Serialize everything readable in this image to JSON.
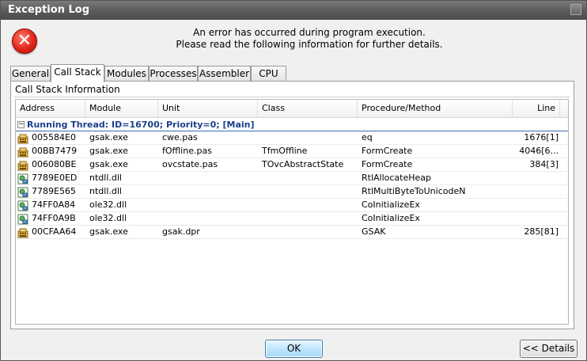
{
  "window": {
    "title": "Exception Log"
  },
  "message": {
    "line1": "An error has occurred during program execution.",
    "line2": "Please read the following information for further details."
  },
  "tabs": [
    "General",
    "Call Stack",
    "Modules",
    "Processes",
    "Assembler",
    "CPU"
  ],
  "active_tab": "Call Stack",
  "section": {
    "title": "Call Stack Information"
  },
  "columns": [
    "Address",
    "Module",
    "Unit",
    "Class",
    "Procedure/Method",
    "Line"
  ],
  "thread": {
    "label": "Running Thread: ID=16700; Priority=0; [Main]",
    "toggle": "−"
  },
  "rows": [
    {
      "icon": "module-icon",
      "address": "005584E0",
      "module": "gsak.exe",
      "unit": "cwe.pas",
      "class": "",
      "method": "eq",
      "line": "1676[1]"
    },
    {
      "icon": "module-icon",
      "address": "00BB7479",
      "module": "gsak.exe",
      "unit": "fOffline.pas",
      "class": "TfmOffline",
      "method": "FormCreate",
      "line": "4046[6..."
    },
    {
      "icon": "module-icon",
      "address": "006080BE",
      "module": "gsak.exe",
      "unit": "ovcstate.pas",
      "class": "TOvcAbstractState",
      "method": "FormCreate",
      "line": "384[3]"
    },
    {
      "icon": "dll-icon",
      "address": "7789E0ED",
      "module": "ntdll.dll",
      "unit": "",
      "class": "",
      "method": "RtlAllocateHeap",
      "line": ""
    },
    {
      "icon": "dll-icon",
      "address": "7789E565",
      "module": "ntdll.dll",
      "unit": "",
      "class": "",
      "method": "RtlMultiByteToUnicodeN",
      "line": ""
    },
    {
      "icon": "dll-icon",
      "address": "74FF0A84",
      "module": "ole32.dll",
      "unit": "",
      "class": "",
      "method": "CoInitializeEx",
      "line": ""
    },
    {
      "icon": "dll-icon",
      "address": "74FF0A9B",
      "module": "ole32.dll",
      "unit": "",
      "class": "",
      "method": "CoInitializeEx",
      "line": ""
    },
    {
      "icon": "module-icon",
      "address": "00CFAA64",
      "module": "gsak.exe",
      "unit": "gsak.dpr",
      "class": "",
      "method": "GSAK",
      "line": "285[81]"
    }
  ],
  "buttons": {
    "ok": "OK",
    "details": "<< Details"
  },
  "colors": {
    "thread_label": "#1a3f8c",
    "error": "#e1261a",
    "ok_border": "#3c7fb1"
  }
}
